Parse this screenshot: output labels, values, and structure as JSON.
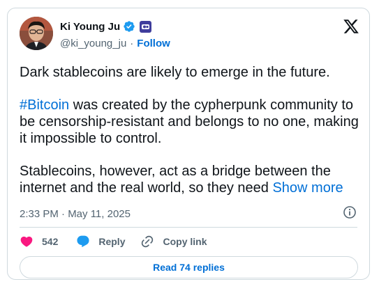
{
  "author": {
    "display_name": "Ki Young Ju",
    "handle": "@ki_young_ju",
    "separator": "·",
    "follow_label": "Follow",
    "verified": true
  },
  "tweet": {
    "line1": "Dark stablecoins are likely to emerge in the future.",
    "hashtag": "#Bitcoin",
    "para2_rest": " was created by the cypherpunk community to be censorship-resistant and belongs to no one, making it impossible to control.",
    "para3": "Stablecoins, however, act as a bridge between the internet and the real world, so they need ",
    "show_more": "Show more",
    "timestamp": "2:33 PM · May 11, 2025"
  },
  "actions": {
    "like_count": "542",
    "reply_label": "Reply",
    "copy_link_label": "Copy link"
  },
  "footer": {
    "read_replies_label": "Read 74 replies"
  },
  "colors": {
    "accent_blue": "#006fd6",
    "like_pink": "#f91880",
    "reply_blue": "#1d9bf0",
    "muted_gray": "#536471",
    "border": "#cfd9de"
  }
}
